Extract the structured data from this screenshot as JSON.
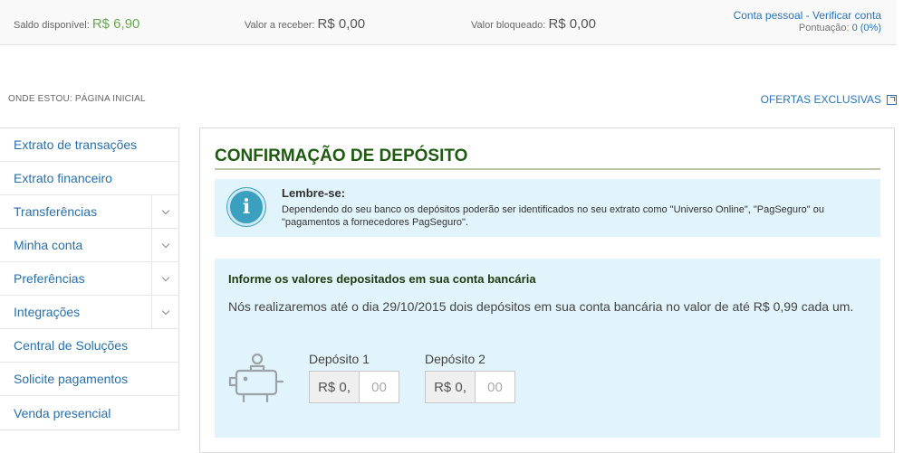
{
  "balances": {
    "available_label": "Saldo disponível:",
    "available_value": "R$ 6,90",
    "receivable_label": "Valor a receber:",
    "receivable_value": "R$ 0,00",
    "blocked_label": "Valor bloqueado:",
    "blocked_value": "R$ 0,00"
  },
  "account": {
    "type_link": "Conta pessoal",
    "separator": " - ",
    "verify_link": "Verificar conta",
    "score_label": "Pontuação:",
    "score_value": "0 (0%)"
  },
  "breadcrumb": "ONDE ESTOU: PÁGINA INICIAL",
  "offers_link": "OFERTAS EXCLUSIVAS",
  "sidebar": {
    "items": [
      {
        "label": "Extrato de transações",
        "expandable": false
      },
      {
        "label": "Extrato financeiro",
        "expandable": false
      },
      {
        "label": "Transferências",
        "expandable": true
      },
      {
        "label": "Minha conta",
        "expandable": true
      },
      {
        "label": "Preferências",
        "expandable": true
      },
      {
        "label": "Integrações",
        "expandable": true
      },
      {
        "label": "Central de Soluções",
        "expandable": false
      },
      {
        "label": "Solicite pagamentos",
        "expandable": false
      },
      {
        "label": "Venda presencial",
        "expandable": false
      }
    ]
  },
  "main": {
    "title": "CONFIRMAÇÃO DE DEPÓSITO",
    "reminder": {
      "icon": "info-icon",
      "icon_glyph": "i",
      "title": "Lembre-se:",
      "text": "Dependendo do seu banco os depósitos poderão ser identificados no seu extrato como \"Universo Online\", \"PagSeguro\" ou \"pagamentos a fornecedores PagSeguro\"."
    },
    "deposit": {
      "title": "Informe os valores depositados em sua conta bancária",
      "description": "Nós realizaremos até o dia 29/10/2015 dois depósitos em sua conta bancária no valor de até R$ 0,99 cada um.",
      "fields": [
        {
          "label": "Depósito 1",
          "prefix": "R$ 0,",
          "placeholder": "00",
          "value": ""
        },
        {
          "label": "Depósito 2",
          "prefix": "R$ 0,",
          "placeholder": "00",
          "value": ""
        }
      ]
    }
  },
  "colors": {
    "link": "#2a73b5",
    "title_green": "#1f5a12",
    "available_green": "#6aa84f",
    "panel_bg": "#e1f4fb",
    "info_icon": "#3b9fbf"
  }
}
